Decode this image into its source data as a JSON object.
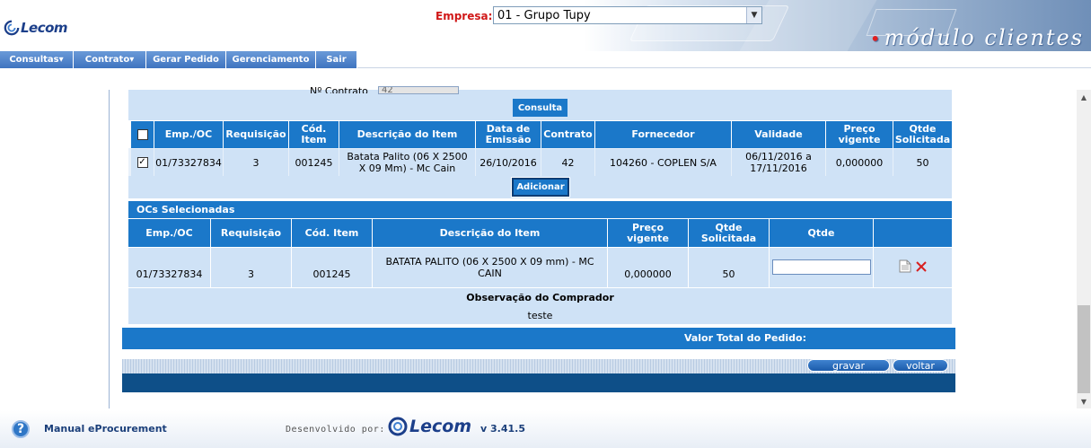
{
  "header": {
    "logo_text": "Lecom",
    "company_label": "Empresa:",
    "company_value": "01 - Grupo Tupy",
    "module_title": "módulo clientes"
  },
  "menu": {
    "items": [
      "Consultas▾",
      "Contrato▾",
      "Gerar Pedido",
      "Gerenciamento",
      "Sair"
    ]
  },
  "filter": {
    "contract_label": "Nº Contrato",
    "contract_value": "42",
    "search_button": "Consulta"
  },
  "results_table": {
    "headers": [
      "Emp./OC",
      "Requisição",
      "Cód. Item",
      "Descrição do Item",
      "Data de Emissão",
      "Contrato",
      "Fornecedor",
      "Validade",
      "Preço vigente",
      "Qtde Solicitada"
    ],
    "rows": [
      {
        "checked": true,
        "emp_oc": "01/73327834",
        "requisicao": "3",
        "cod_item": "001245",
        "descricao": "Batata Palito (06 X 2500 X 09 Mm) - Mc Cain",
        "data_emissao": "26/10/2016",
        "contrato": "42",
        "fornecedor": "104260 - COPLEN S/A",
        "validade": "06/11/2016 a 17/11/2016",
        "preco": "0,000000",
        "qtde": "50"
      }
    ],
    "add_button": "Adicionar"
  },
  "selected": {
    "title": "OCs Selecionadas",
    "headers": [
      "Emp./OC",
      "Requisição",
      "Cód. Item",
      "Descrição do Item",
      "Preço vigente",
      "Qtde Solicitada",
      "Qtde"
    ],
    "rows": [
      {
        "emp_oc": "01/73327834",
        "requisicao": "3",
        "cod_item": "001245",
        "descricao": "BATATA PALITO (06 X 2500 X 09 mm) - MC CAIN",
        "preco": "0,000000",
        "qtde_solicitada": "50",
        "qtde": ""
      }
    ],
    "obs_label": "Observação do Comprador",
    "obs_value": "teste",
    "total_label": "Valor Total do Pedido:"
  },
  "actions": {
    "save": "gravar",
    "back": "voltar"
  },
  "footer": {
    "manual": "Manual eProcurement",
    "dev_label": "Desenvolvido por:",
    "logo_text": "Lecom",
    "version": "v 3.41.5"
  },
  "icons": {
    "help": "help-icon",
    "document": "document-icon",
    "delete": "delete-icon"
  },
  "colors": {
    "header_blue": "#1b78c9",
    "row_blue": "#cfe2f6",
    "company_label": "#d01818"
  }
}
